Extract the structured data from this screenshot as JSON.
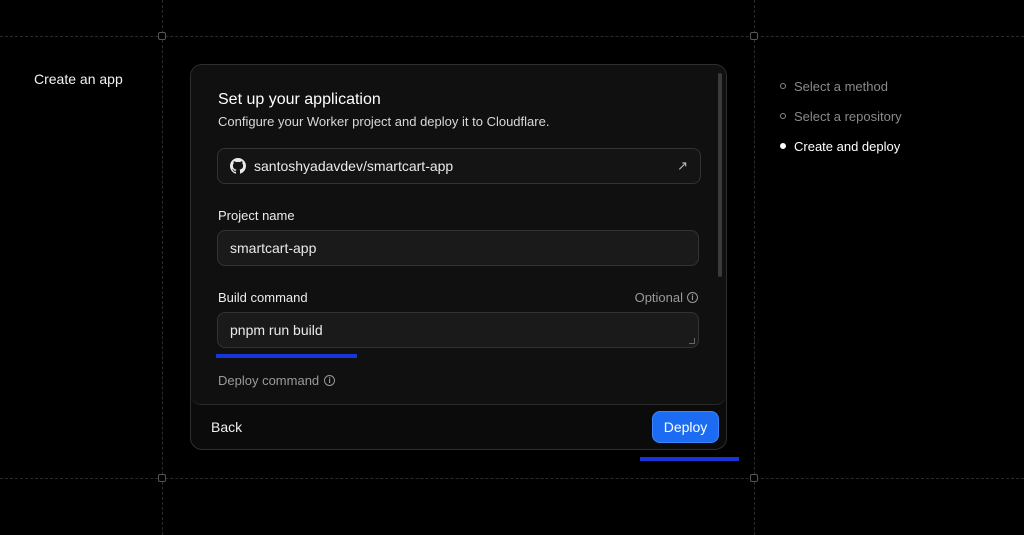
{
  "page": {
    "title": "Create an app"
  },
  "card": {
    "title": "Set up your application",
    "subtitle": "Configure your Worker project and deploy it to Cloudflare.",
    "repository": "santoshyadavdev/smartcart-app",
    "project_name": {
      "label": "Project name",
      "value": "smartcart-app"
    },
    "build_command": {
      "label": "Build command",
      "optional": "Optional",
      "value": "pnpm run build"
    },
    "deploy_command": {
      "label": "Deploy command"
    }
  },
  "footer": {
    "back_label": "Back",
    "deploy_label": "Deploy"
  },
  "steps": [
    {
      "label": "Select a method",
      "state": "done"
    },
    {
      "label": "Select a repository",
      "state": "done"
    },
    {
      "label": "Create and deploy",
      "state": "active"
    }
  ],
  "icons": {
    "repo": "github-icon",
    "external": "external-link-icon",
    "info": "info-icon"
  },
  "colors": {
    "accent": "#1b6cf2",
    "highlight": "#1636d9"
  }
}
